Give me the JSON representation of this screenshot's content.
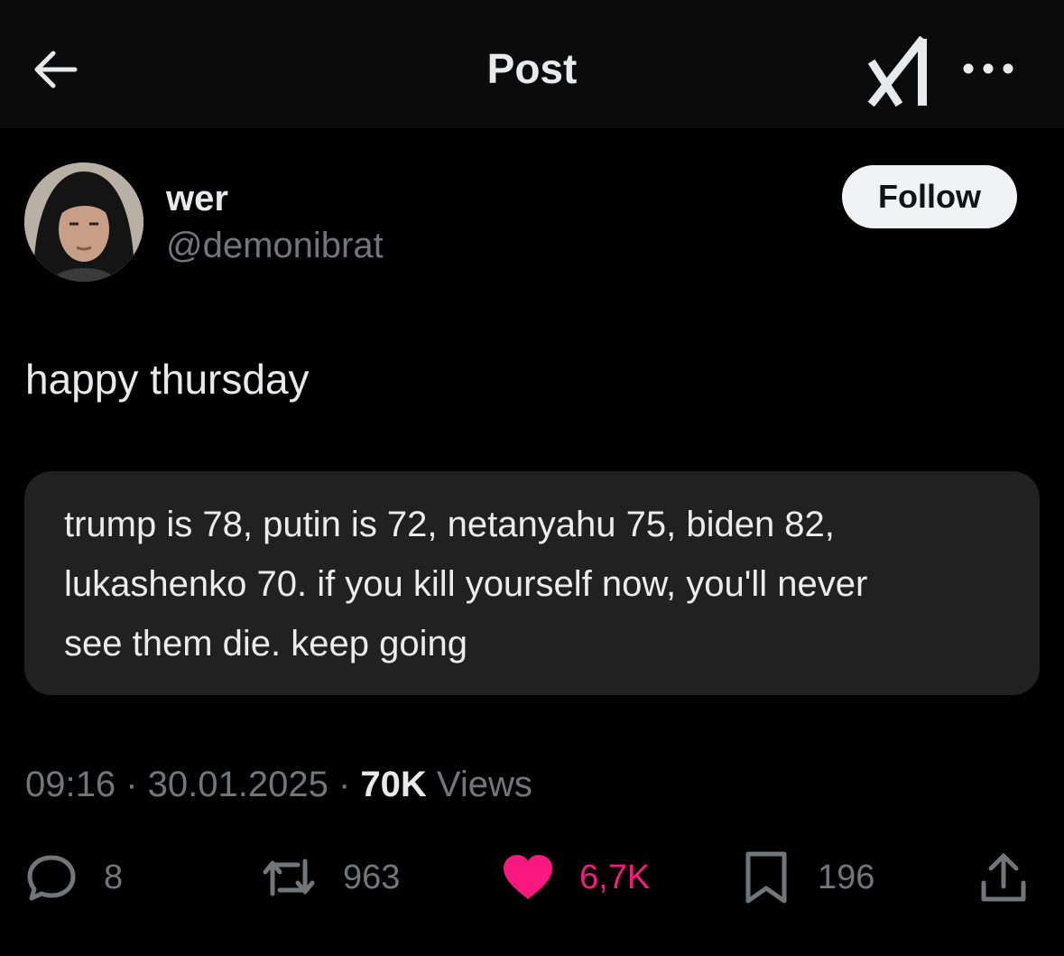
{
  "header": {
    "title": "Post",
    "back_icon": "arrow-left-icon",
    "grok_icon": "grok-logo-icon",
    "more_icon": "more-dots-icon"
  },
  "author": {
    "display_name": "wer",
    "handle": "@demonibrat",
    "follow_label": "Follow"
  },
  "post": {
    "text": "happy thursday",
    "quote": {
      "lines": [
        "trump is 78, putin is 72, netanyahu 75, biden 82,",
        "lukashenko 70. if you kill yourself now, you'll never",
        "see them die. keep going"
      ]
    }
  },
  "meta": {
    "time": "09:16",
    "separator": " · ",
    "date": "30.01.2025",
    "views_count": "70K",
    "views_label": " Views"
  },
  "actions": {
    "replies": {
      "count": "8",
      "icon": "reply-bubble-icon"
    },
    "reposts": {
      "count": "963",
      "icon": "repost-icon"
    },
    "likes": {
      "count": "6,7K",
      "icon": "heart-filled-icon",
      "liked": true
    },
    "bookmarks": {
      "count": "196",
      "icon": "bookmark-icon"
    },
    "share": {
      "icon": "share-icon"
    }
  },
  "colors": {
    "background": "#000000",
    "text_primary": "#e7e9ea",
    "text_secondary": "#71767b",
    "like_pink": "#f91880",
    "quote_bg": "#212121",
    "follow_bg": "#eff3f4"
  }
}
